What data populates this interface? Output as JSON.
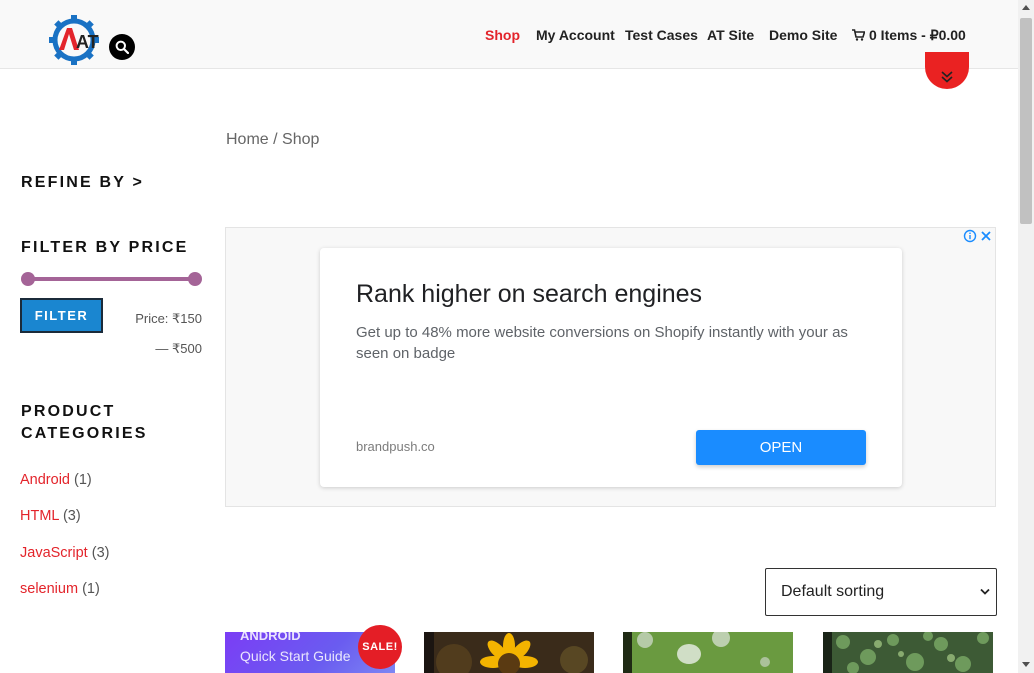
{
  "header": {
    "logo_text": "AT",
    "nav": [
      {
        "label": "Shop",
        "active": true
      },
      {
        "label": "My Account",
        "active": false
      },
      {
        "label": "Test Cases",
        "active": false
      },
      {
        "label": "AT Site",
        "active": false
      },
      {
        "label": "Demo Site",
        "active": false
      }
    ],
    "cart_label": "0 Items - ₽0.00",
    "icons": [
      "search-icon",
      "cart-icon",
      "double-chevron-down-icon"
    ]
  },
  "sidebar": {
    "refine_title": "REFINE BY >",
    "filter_title": "FILTER BY PRICE",
    "filter_button": "FILTER",
    "price_text": "Price: ₹150 — ₹500",
    "price_range": {
      "min": 150,
      "max": 500,
      "slider_min_fraction": 0,
      "slider_max_fraction": 1
    },
    "categories_title_line1": "PRODUCT",
    "categories_title_line2": "CATEGORIES",
    "categories": [
      {
        "name": "Android",
        "count": "(1)"
      },
      {
        "name": "HTML",
        "count": "(3)"
      },
      {
        "name": "JavaScript",
        "count": "(3)"
      },
      {
        "name": "selenium",
        "count": "(1)"
      }
    ]
  },
  "main": {
    "breadcrumb_home": "Home",
    "breadcrumb_sep": " / ",
    "breadcrumb_current": "Shop",
    "ad": {
      "headline": "Rank higher on search engines",
      "description": "Get up to 48% more website conversions on Shopify instantly with your as seen on badge",
      "domain": "brandpush.co",
      "button": "OPEN"
    },
    "sorting": "Default sorting",
    "products": [
      {
        "label_line1": "ANDROID",
        "label_line2": "Quick Start Guide",
        "sale": "SALE!"
      },
      {
        "image": "sunflower"
      },
      {
        "image": "water-drops"
      },
      {
        "image": "plants"
      }
    ]
  },
  "colors": {
    "accent": "#e3242b",
    "slider": "#a46497",
    "filter_button": "#1a86d0",
    "ad_button": "#1a8cff"
  }
}
